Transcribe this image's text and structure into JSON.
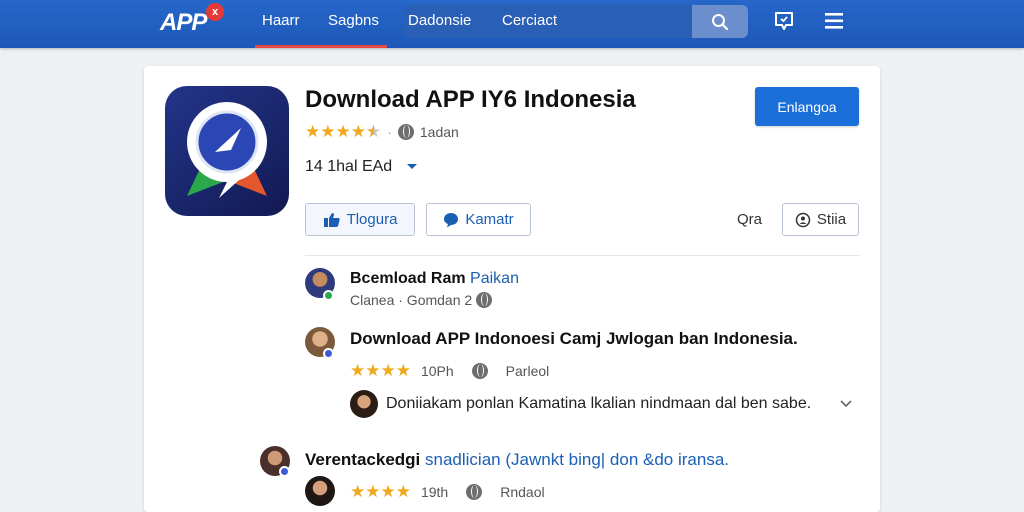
{
  "topbar": {
    "logo": "APP",
    "logo_badge": "x",
    "nav": [
      "Haarr",
      "Sagbns",
      "Dadonsie",
      "Cerciact"
    ],
    "colors": {
      "bar": "#1d58b8",
      "accent": "#e24a4a"
    }
  },
  "app": {
    "title": "Download APP IY6 Indonesia",
    "rating_stars": 4.5,
    "rating_label": "1adan",
    "install_label": "14 1hal EAd",
    "primary_button": "Enlangoa",
    "like_button": "Tlogura",
    "comment_button": "Kamatr",
    "ora_label": "Qra",
    "share_button": "Stiia"
  },
  "feed": {
    "post1": {
      "title_bold": "Bcemload Ram",
      "title_link": "Paikan",
      "meta": "Clanea · Gomdan 2"
    },
    "post2": {
      "text": "Download APP Indonoesi Camj Jwlogan ban Indonesia.",
      "stars": 4,
      "time": "10Ph",
      "action": "Parleol",
      "reply": "Doniiakam ponlan Kamatina lkalian nindmaan dal ben sabe."
    },
    "post3": {
      "title_bold": "Verentackedgi",
      "title_link": "snadlician (Jawnkt bing| don &do iransa.",
      "stars": 4,
      "time": "19th",
      "action": "Rndaol"
    }
  }
}
